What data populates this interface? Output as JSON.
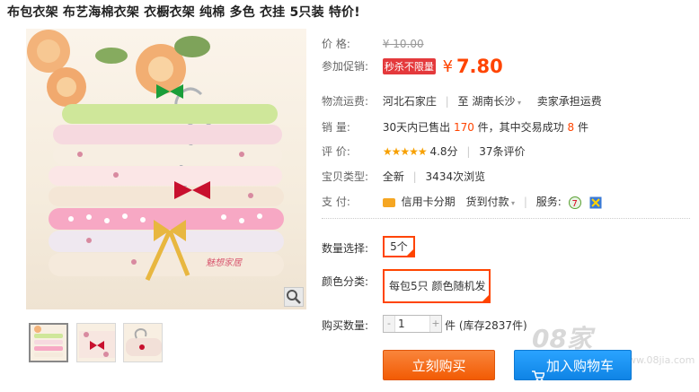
{
  "title": "布包衣架 布艺海棉衣架 衣橱衣架 纯棉 多色 衣挂 5只装 特价!",
  "gallery": {
    "watermark": "魅想家居",
    "zoom_icon": "magnifier-icon",
    "thumbnails": [
      "thumb-1",
      "thumb-2",
      "thumb-3"
    ]
  },
  "price": {
    "label": "价  格:",
    "original": "¥ 10.00"
  },
  "promo": {
    "label": "参加促销:",
    "tag": "秒杀不限量",
    "currency": "¥",
    "price": "7.80"
  },
  "shipping": {
    "label": "物流运费:",
    "from": "河北石家庄",
    "sep": "|",
    "to_prefix": "至",
    "to": "湖南长沙",
    "note": "卖家承担运费"
  },
  "sales": {
    "label": "销  量:",
    "prefix": "30天内已售出",
    "count": "170",
    "mid": "件，其中交易成功",
    "success": "8",
    "suffix": "件"
  },
  "rating": {
    "label": "评  价:",
    "stars": "★★★★★",
    "score": "4.8分",
    "reviews": "37条评价"
  },
  "type": {
    "label": "宝贝类型:",
    "value": "全新",
    "views": "3434次浏览"
  },
  "payment": {
    "label": "支  付:",
    "card": "信用卡分期",
    "cod": "货到付款",
    "service_label": "服务:"
  },
  "quantity_select": {
    "label": "数量选择:",
    "option": "5个"
  },
  "color": {
    "label": "颜色分类:",
    "option": "每包5只 颜色随机发"
  },
  "buy_qty": {
    "label": "购买数量:",
    "minus": "-",
    "value": "1",
    "plus": "+",
    "stock": "件 (库存2837件)"
  },
  "buttons": {
    "buy": "立刻购买",
    "cart": "加入购物车"
  },
  "site_watermark": {
    "main": "08家",
    "sub": "www.08jia.com"
  },
  "colors": {
    "accent": "#ff4400",
    "buy": "#f25b04",
    "cart": "#0f84e5"
  }
}
